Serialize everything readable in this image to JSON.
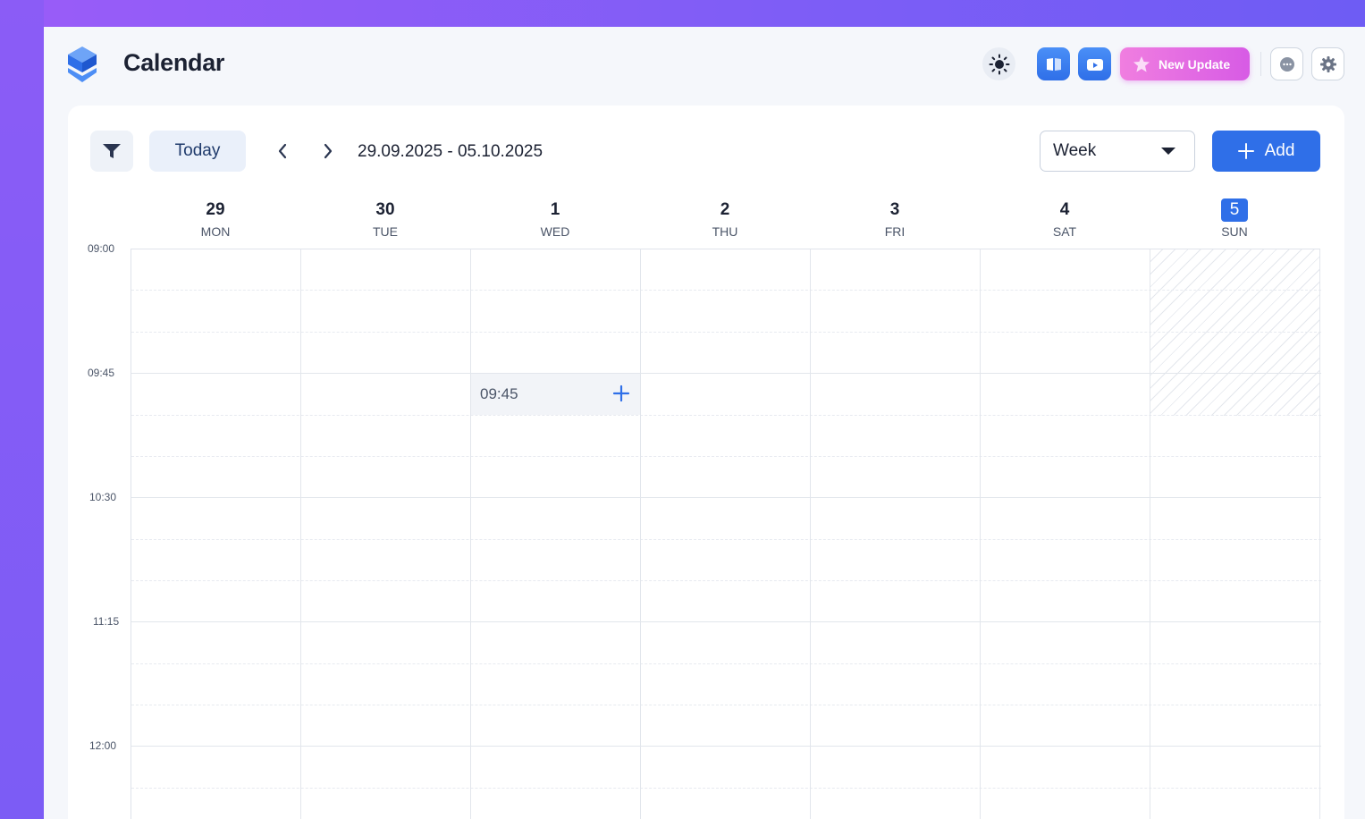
{
  "header": {
    "title": "Calendar",
    "update_label": "New Update",
    "icons": [
      "logo-icon",
      "sun-icon",
      "book-icon",
      "video-icon",
      "star-icon",
      "chat-icon",
      "gear-icon"
    ],
    "accent": "#2f6fe8",
    "update_gradient": [
      "#f07ee0",
      "#d75be5"
    ]
  },
  "toolbar": {
    "today_label": "Today",
    "date_range": "29.09.2025 - 05.10.2025",
    "view_selected": "Week",
    "add_label": "Add"
  },
  "days": [
    {
      "num": "29",
      "name": "MON"
    },
    {
      "num": "30",
      "name": "TUE"
    },
    {
      "num": "1",
      "name": "WED"
    },
    {
      "num": "2",
      "name": "THU"
    },
    {
      "num": "3",
      "name": "FRI"
    },
    {
      "num": "4",
      "name": "SAT"
    },
    {
      "num": "5",
      "name": "SUN",
      "today": true
    }
  ],
  "time_labels": [
    "09:00",
    "09:45",
    "10:30",
    "11:15",
    "12:00"
  ],
  "hover_slot": {
    "time": "09:45",
    "day": "WED"
  }
}
